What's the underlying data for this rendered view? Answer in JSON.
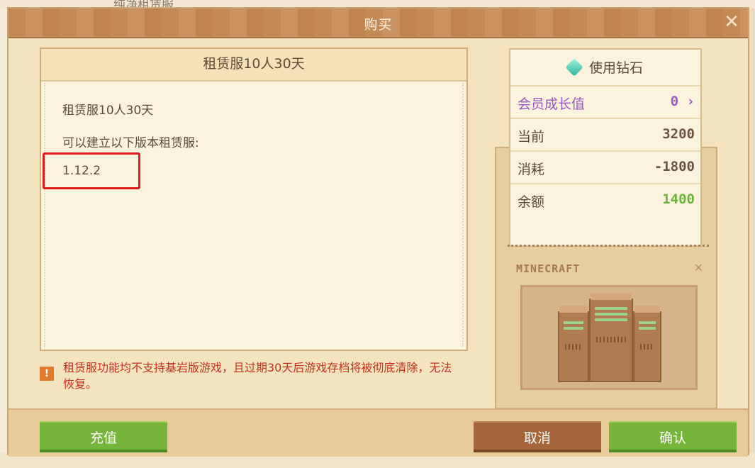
{
  "background": {
    "behind_title": "纯净租赁服"
  },
  "dialog": {
    "title": "购买",
    "close_icon": "close-x-icon"
  },
  "product": {
    "header": "租赁服10人30天",
    "name": "租赁服10人30天",
    "versions_label": "可以建立以下版本租赁服:",
    "version": "1.12.2"
  },
  "warning": {
    "icon": "warning-icon",
    "text": "租赁服功能均不支持基岩版游戏，且过期30天后游戏存档将被彻底清除，无法恢复。"
  },
  "diamond": {
    "header": "使用钻石",
    "member_label": "会员成长值",
    "member_value": "0",
    "member_chevron": "›",
    "current_label": "当前",
    "current_value": "3200",
    "cost_label": "消耗",
    "cost_value": "-1800",
    "balance_label": "余额",
    "balance_value": "1400"
  },
  "minecraft": {
    "logo": "MINECRAFT"
  },
  "buttons": {
    "recharge": "充值",
    "cancel": "取消",
    "confirm": "确认"
  },
  "colors": {
    "accent_green": "#76b43a",
    "cancel_brown": "#a6663a",
    "warning_red": "#c2311e",
    "member_purple": "#9a57c4",
    "balance_green": "#6bb23a"
  }
}
